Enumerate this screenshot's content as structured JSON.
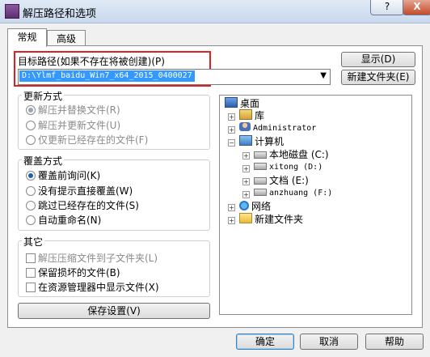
{
  "window": {
    "title": "解压路径和选项",
    "help": "?",
    "close": "X"
  },
  "tabs": [
    {
      "label": "常规"
    },
    {
      "label": "高级"
    }
  ],
  "target": {
    "label": "目标路径(如果不存在将被创建)(P)",
    "value": "D:\\Ylmf_baidu_Win7_x64_2015_0400027",
    "show_button": "显示(D)",
    "new_folder_button": "新建文件夹(E)"
  },
  "update_mode": {
    "title": "更新方式",
    "options": [
      {
        "label": "解压并替换文件(R)"
      },
      {
        "label": "解压并更新文件(U)"
      },
      {
        "label": "仅更新已经存在的文件(F)"
      }
    ]
  },
  "overwrite_mode": {
    "title": "覆盖方式",
    "options": [
      {
        "label": "覆盖前询问(K)"
      },
      {
        "label": "没有提示直接覆盖(W)"
      },
      {
        "label": "跳过已经存在的文件(S)"
      },
      {
        "label": "自动重命名(N)"
      }
    ]
  },
  "misc": {
    "title": "其它",
    "options": [
      {
        "label": "解压压缩文件到子文件夹(L)"
      },
      {
        "label": "保留损坏的文件(B)"
      },
      {
        "label": "在资源管理器中显示文件(X)"
      }
    ]
  },
  "save_button": "保存设置(V)",
  "tree": [
    {
      "label": "桌面",
      "icon": "desktop-icon"
    },
    {
      "label": "库",
      "icon": "library-icon"
    },
    {
      "label": "Administrator",
      "icon": "user-icon"
    },
    {
      "label": "计算机",
      "icon": "computer-icon"
    },
    {
      "label": "本地磁盘 (C:)",
      "icon": "drive-icon"
    },
    {
      "label": "xitong (D:)",
      "icon": "drive-icon"
    },
    {
      "label": "文档 (E:)",
      "icon": "drive-icon"
    },
    {
      "label": "anzhuang (F:)",
      "icon": "drive-icon"
    },
    {
      "label": "网络",
      "icon": "network-icon"
    },
    {
      "label": "新建文件夹",
      "icon": "folder-icon"
    }
  ],
  "footer": {
    "ok": "确定",
    "cancel": "取消",
    "help": "帮助"
  },
  "colors": {
    "highlight_box": "#e02020",
    "selection": "#3399ff"
  }
}
